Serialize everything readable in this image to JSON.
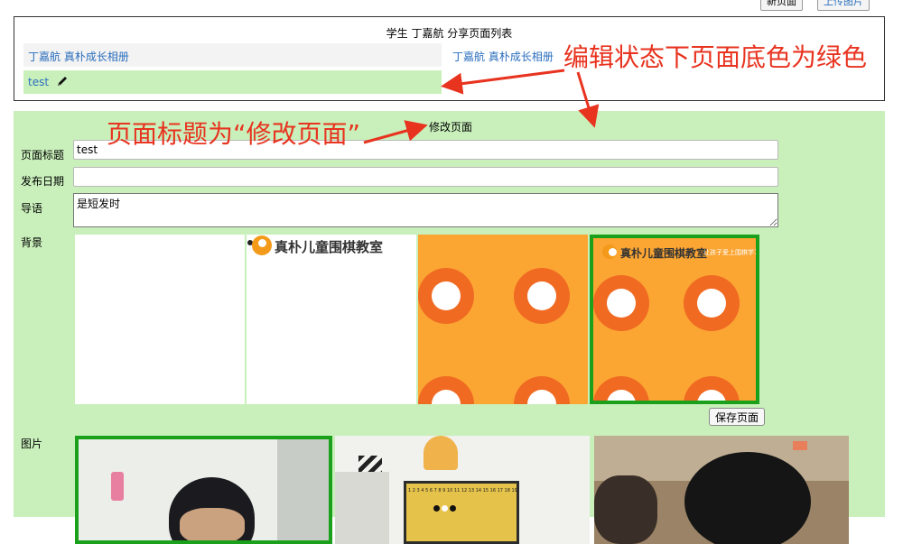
{
  "toolbar": {
    "new_page_label": "新页面",
    "upload_image_label": "上传图片"
  },
  "list": {
    "title": "学生 丁嘉航 分享页面列表",
    "rows": [
      {
        "label": "丁嘉航 真朴成长相册"
      },
      {
        "label": "test"
      }
    ],
    "right_link": "丁嘉航 真朴成长相册"
  },
  "edit": {
    "title": "修改页面",
    "fields": {
      "title_label": "页面标题",
      "title_value": "test",
      "date_label": "发布日期",
      "date_value": "",
      "intro_label": "导语",
      "intro_value": "是短发时"
    },
    "background_label": "背景",
    "backgrounds": [
      {
        "style": "blank"
      },
      {
        "style": "logo",
        "logo_text": "真朴儿童围棋教室"
      },
      {
        "style": "orange-circles"
      },
      {
        "style": "orange-circles-logo",
        "logo_text": "真朴儿童围棋教室",
        "tagline": "让孩子爱上围棋学习",
        "selected": true
      }
    ],
    "save_label": "保存页面",
    "images_label": "图片",
    "photos": [
      {
        "selected": true
      },
      {
        "selected": false,
        "board_numbers": "1 2 3 4 5 6 7 8 9 10 11 12 13 14 15 16 17 18 19"
      },
      {
        "selected": false
      }
    ]
  },
  "annotations": {
    "green_note": "编辑状态下页面底色为绿色",
    "title_note": "页面标题为“修改页面”"
  },
  "colors": {
    "edit_bg": "#c9f0bb",
    "link": "#2a6ebd",
    "selected_border": "#1aa01a",
    "annotation": "#e8331f",
    "orange": "#fba533"
  }
}
